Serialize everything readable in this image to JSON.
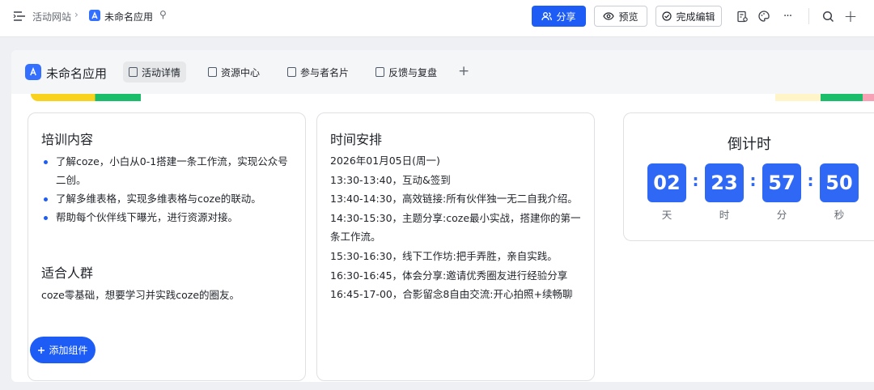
{
  "topbar": {
    "breadcrumb_parent": "活动网站",
    "breadcrumb_sep": "›",
    "breadcrumb_current": "未命名应用",
    "share_label": "分享",
    "preview_label": "预览",
    "done_label": "完成编辑",
    "pin_glyph": "⚲",
    "more_glyph": "···",
    "add_glyph": "+"
  },
  "app": {
    "title": "未命名应用",
    "tabs": [
      {
        "label": "活动详情",
        "active": true
      },
      {
        "label": "资源中心",
        "active": false
      },
      {
        "label": "参与者名片",
        "active": false
      },
      {
        "label": "反馈与复盘",
        "active": false
      }
    ],
    "tab_add": "+"
  },
  "training": {
    "heading": "培训内容",
    "bullets": [
      "了解coze，小白从0-1搭建一条工作流，实现公众号二创。",
      "了解多维表格，实现多维表格与coze的联动。",
      "帮助每个伙伴线下曝光，进行资源对接。"
    ],
    "audience_heading": "适合人群",
    "audience_text": "coze零基础，想要学习并实践coze的圈友。"
  },
  "schedule": {
    "heading": "时间安排",
    "items": [
      "2026年01月05日(周一)",
      "13:30-13:40，互动&签到",
      "13:40-14:30，高效链接:所有伙伴独一无二自我介绍。",
      "14:30-15:30，主题分享:coze最小实战，搭建你的第一条工作流。",
      "15:30-16:30，线下工作坊:把手弄胜，亲自实践。",
      "16:30-16:45，体会分享:邀请优秀圈友进行经验分享",
      "16:45-17-00，合影留念8自由交流:开心拍照+续畅聊"
    ]
  },
  "countdown": {
    "title": "倒计时",
    "units": [
      {
        "value": "02",
        "label": "天"
      },
      {
        "value": "23",
        "label": "时"
      },
      {
        "value": "57",
        "label": "分"
      },
      {
        "value": "50",
        "label": "秒"
      }
    ],
    "colon": ":"
  },
  "add_component_label": "添加组件",
  "colors": {
    "primary": "#1d5df5",
    "countdown": "#2f68f5"
  }
}
